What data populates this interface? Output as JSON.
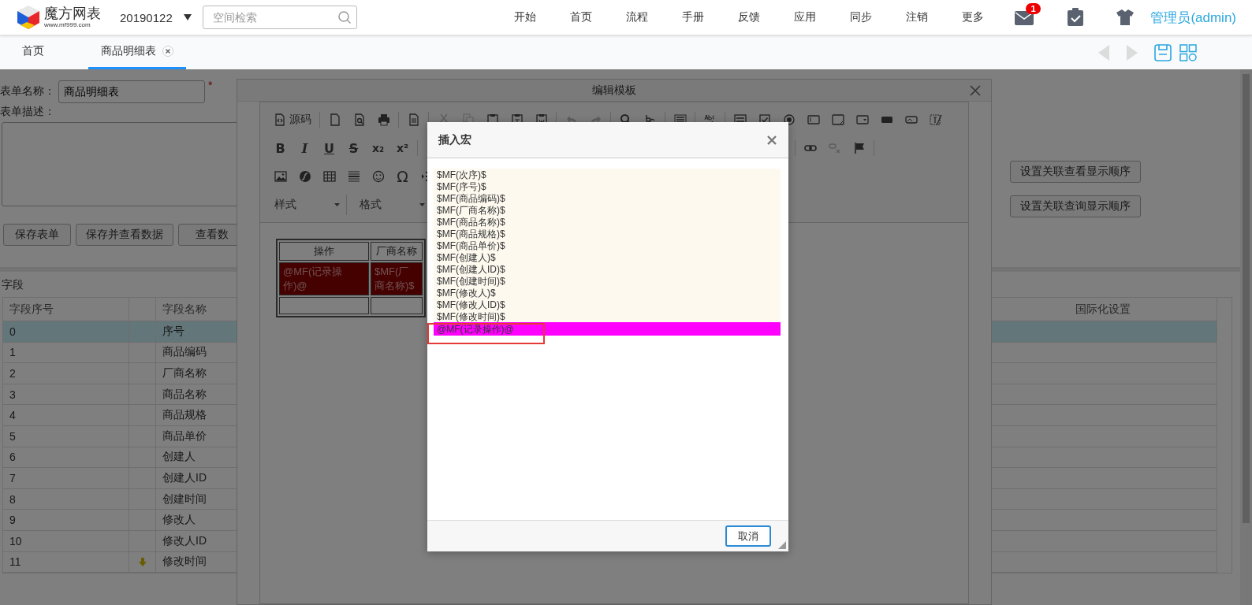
{
  "header": {
    "logo_title": "魔方网表",
    "logo_url": "www.mf999.com",
    "space": "20190122",
    "search": {
      "placeholder": "空间检索"
    },
    "nav": [
      "开始",
      "首页",
      "流程",
      "手册",
      "反馈",
      "应用",
      "同步",
      "注销",
      "更多"
    ],
    "mail_badge": "1",
    "user": "管理员(admin)"
  },
  "tabs": [
    {
      "label": "首页",
      "selected": false,
      "closable": false
    },
    {
      "label": "商品明细表",
      "selected": true,
      "closable": true
    }
  ],
  "form": {
    "name_label": "表单名称：",
    "name_value": "商品明细表",
    "required_mark": "*",
    "desc_label": "表单描述：",
    "buttons": [
      "保存表单",
      "保存并查看数据",
      "查看数"
    ]
  },
  "right_buttons": [
    "设置关联查看显示顺序",
    "设置关联查询显示顺序"
  ],
  "fields": {
    "title": "字段",
    "columns": [
      "字段序号",
      "字段名称",
      "国际化设置"
    ],
    "rows": [
      {
        "index": "0",
        "name": "序号",
        "selected": true,
        "sort_mark": false
      },
      {
        "index": "1",
        "name": "商品编码",
        "selected": false,
        "sort_mark": false
      },
      {
        "index": "2",
        "name": "厂商名称",
        "selected": false,
        "sort_mark": false
      },
      {
        "index": "3",
        "name": "商品名称",
        "selected": false,
        "sort_mark": false
      },
      {
        "index": "4",
        "name": "商品规格",
        "selected": false,
        "sort_mark": false
      },
      {
        "index": "5",
        "name": "商品单价",
        "selected": false,
        "sort_mark": false
      },
      {
        "index": "6",
        "name": "创建人",
        "selected": false,
        "sort_mark": false
      },
      {
        "index": "7",
        "name": "创建人ID",
        "selected": false,
        "sort_mark": false
      },
      {
        "index": "8",
        "name": "创建时间",
        "selected": false,
        "sort_mark": false
      },
      {
        "index": "9",
        "name": "修改人",
        "selected": false,
        "sort_mark": false
      },
      {
        "index": "10",
        "name": "修改人ID",
        "selected": false,
        "sort_mark": false
      },
      {
        "index": "11",
        "name": "修改时间",
        "selected": false,
        "sort_mark": true
      }
    ]
  },
  "editor": {
    "title": "编辑模板",
    "toolbar": [
      {
        "left": [
          {
            "kind": "source",
            "label": "源码",
            "disabled": false
          },
          {
            "kind": "separator"
          },
          {
            "kind": "newpage",
            "disabled": false
          },
          {
            "kind": "preview",
            "disabled": false
          },
          {
            "kind": "print",
            "disabled": false
          },
          {
            "kind": "separator"
          },
          {
            "kind": "templates",
            "disabled": false
          },
          {
            "kind": "separator"
          },
          {
            "kind": "cut",
            "disabled": true
          },
          {
            "kind": "copy",
            "disabled": true
          },
          {
            "kind": "paste",
            "disabled": false
          },
          {
            "kind": "paste_text",
            "disabled": false
          },
          {
            "kind": "paste_word",
            "disabled": false
          },
          {
            "kind": "separator"
          },
          {
            "kind": "undo",
            "disabled": true
          },
          {
            "kind": "redo",
            "disabled": true
          },
          {
            "kind": "separator"
          },
          {
            "kind": "find",
            "disabled": false
          },
          {
            "kind": "replace",
            "disabled": false
          },
          {
            "kind": "separator"
          },
          {
            "kind": "select_all",
            "disabled": false
          },
          {
            "kind": "separator"
          },
          {
            "kind": "spellcheck",
            "disabled": false
          },
          {
            "kind": "separator"
          },
          {
            "kind": "form",
            "disabled": false
          },
          {
            "kind": "checkbox",
            "disabled": false
          },
          {
            "kind": "radio",
            "disabled": false
          },
          {
            "kind": "textfield",
            "disabled": false
          },
          {
            "kind": "textarea",
            "disabled": false
          },
          {
            "kind": "select",
            "disabled": false
          },
          {
            "kind": "button",
            "disabled": false
          },
          {
            "kind": "imagebutton",
            "disabled": false
          },
          {
            "kind": "hidden",
            "disabled": false
          }
        ]
      },
      {
        "left": [
          {
            "kind": "bold",
            "label": "B",
            "disabled": false
          },
          {
            "kind": "italic",
            "label": "I",
            "disabled": false
          },
          {
            "kind": "underline",
            "label": "U",
            "disabled": false
          },
          {
            "kind": "strike",
            "label": "S",
            "disabled": false
          },
          {
            "kind": "sub",
            "label": "x₂",
            "disabled": false
          },
          {
            "kind": "sup",
            "label": "x²",
            "disabled": false
          },
          {
            "kind": "separator"
          }
        ],
        "right": [
          {
            "kind": "separator"
          },
          {
            "kind": "link",
            "disabled": false
          },
          {
            "kind": "unlink",
            "disabled": true
          },
          {
            "kind": "anchor",
            "disabled": false
          },
          {
            "kind": "separator"
          }
        ]
      },
      {
        "left": [
          {
            "kind": "image",
            "disabled": false
          },
          {
            "kind": "flash",
            "disabled": false
          },
          {
            "kind": "table",
            "disabled": false
          },
          {
            "kind": "hr",
            "disabled": false
          },
          {
            "kind": "smiley",
            "disabled": false
          },
          {
            "kind": "omega",
            "label": "Ω",
            "disabled": false
          },
          {
            "kind": "indent"
          }
        ]
      }
    ],
    "dropdowns": [
      "样式",
      "格式"
    ],
    "table": {
      "headers": [
        "操作",
        "厂商名称"
      ],
      "cells": [
        "@MF(记录操作)@",
        "$MF(厂商名称)$"
      ]
    }
  },
  "macro_dialog": {
    "title": "插入宏",
    "items": [
      {
        "text": "$MF(次序)$",
        "selected": false
      },
      {
        "text": "$MF(序号)$",
        "selected": false
      },
      {
        "text": "$MF(商品编码)$",
        "selected": false
      },
      {
        "text": "$MF(厂商名称)$",
        "selected": false
      },
      {
        "text": "$MF(商品名称)$",
        "selected": false
      },
      {
        "text": "$MF(商品规格)$",
        "selected": false
      },
      {
        "text": "$MF(商品单价)$",
        "selected": false
      },
      {
        "text": "$MF(创建人)$",
        "selected": false
      },
      {
        "text": "$MF(创建人ID)$",
        "selected": false
      },
      {
        "text": "$MF(创建时间)$",
        "selected": false
      },
      {
        "text": "$MF(修改人)$",
        "selected": false
      },
      {
        "text": "$MF(修改人ID)$",
        "selected": false
      },
      {
        "text": "$MF(修改时间)$",
        "selected": false
      },
      {
        "text": "@MF(记录操作)@",
        "selected": true
      }
    ],
    "cancel": "取消"
  }
}
